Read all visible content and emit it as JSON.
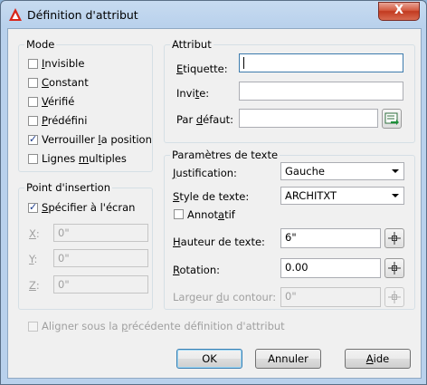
{
  "window": {
    "title": "Définition d'attribut",
    "close_label": "X"
  },
  "mode": {
    "title": "Mode",
    "items": [
      {
        "pre": "",
        "key": "I",
        "post": "nvisible",
        "checked": false
      },
      {
        "pre": "",
        "key": "C",
        "post": "onstant",
        "checked": false
      },
      {
        "pre": "",
        "key": "V",
        "post": "érifié",
        "checked": false
      },
      {
        "pre": "",
        "key": "P",
        "post": "rédéfini",
        "checked": false
      },
      {
        "pre": "Verrouiller ",
        "key": "l",
        "post": "a position",
        "checked": true
      },
      {
        "pre": "Lignes ",
        "key": "m",
        "post": "ultiples",
        "checked": false
      }
    ]
  },
  "insertion": {
    "title": "Point d'insertion",
    "specify": {
      "pre": "",
      "key": "S",
      "post": "pécifier à l'écran",
      "checked": true
    },
    "x": {
      "key": "X",
      "post": ":",
      "value": "0\""
    },
    "y": {
      "key": "Y",
      "post": ":",
      "value": "0\""
    },
    "z": {
      "key": "Z",
      "post": ":",
      "value": "0\""
    }
  },
  "attribut": {
    "title": "Attribut",
    "etiquette": {
      "key": "E",
      "post": "tiquette:",
      "value": ""
    },
    "invite": {
      "pre": "Invi",
      "key": "t",
      "post": "e:",
      "value": ""
    },
    "defaut": {
      "pre": "Par ",
      "key": "d",
      "post": "éfaut:",
      "value": ""
    }
  },
  "texte": {
    "title": "Paramètres de texte",
    "justification": {
      "key": "J",
      "post": "ustification:",
      "value": "Gauche"
    },
    "style": {
      "pre": "",
      "key": "S",
      "post": "tyle de texte:",
      "value": "ARCHITXT"
    },
    "annotatif": {
      "pre": "Annot",
      "key": "a",
      "post": "tif",
      "checked": false
    },
    "hauteur": {
      "key": "H",
      "post": "auteur de texte:",
      "value": "6\""
    },
    "rotation": {
      "key": "R",
      "post": "otation:",
      "value": "0.00"
    },
    "largeur": {
      "pre": "Largeur ",
      "key": "d",
      "post": "u contour:",
      "value": "0\""
    }
  },
  "align": {
    "pre": "Aligner sous la ",
    "key": "p",
    "post": "récédente définition d'attribut",
    "checked": false
  },
  "buttons": {
    "ok": "OK",
    "annuler": "Annuler",
    "aide_key": "A",
    "aide_post": "ide"
  }
}
